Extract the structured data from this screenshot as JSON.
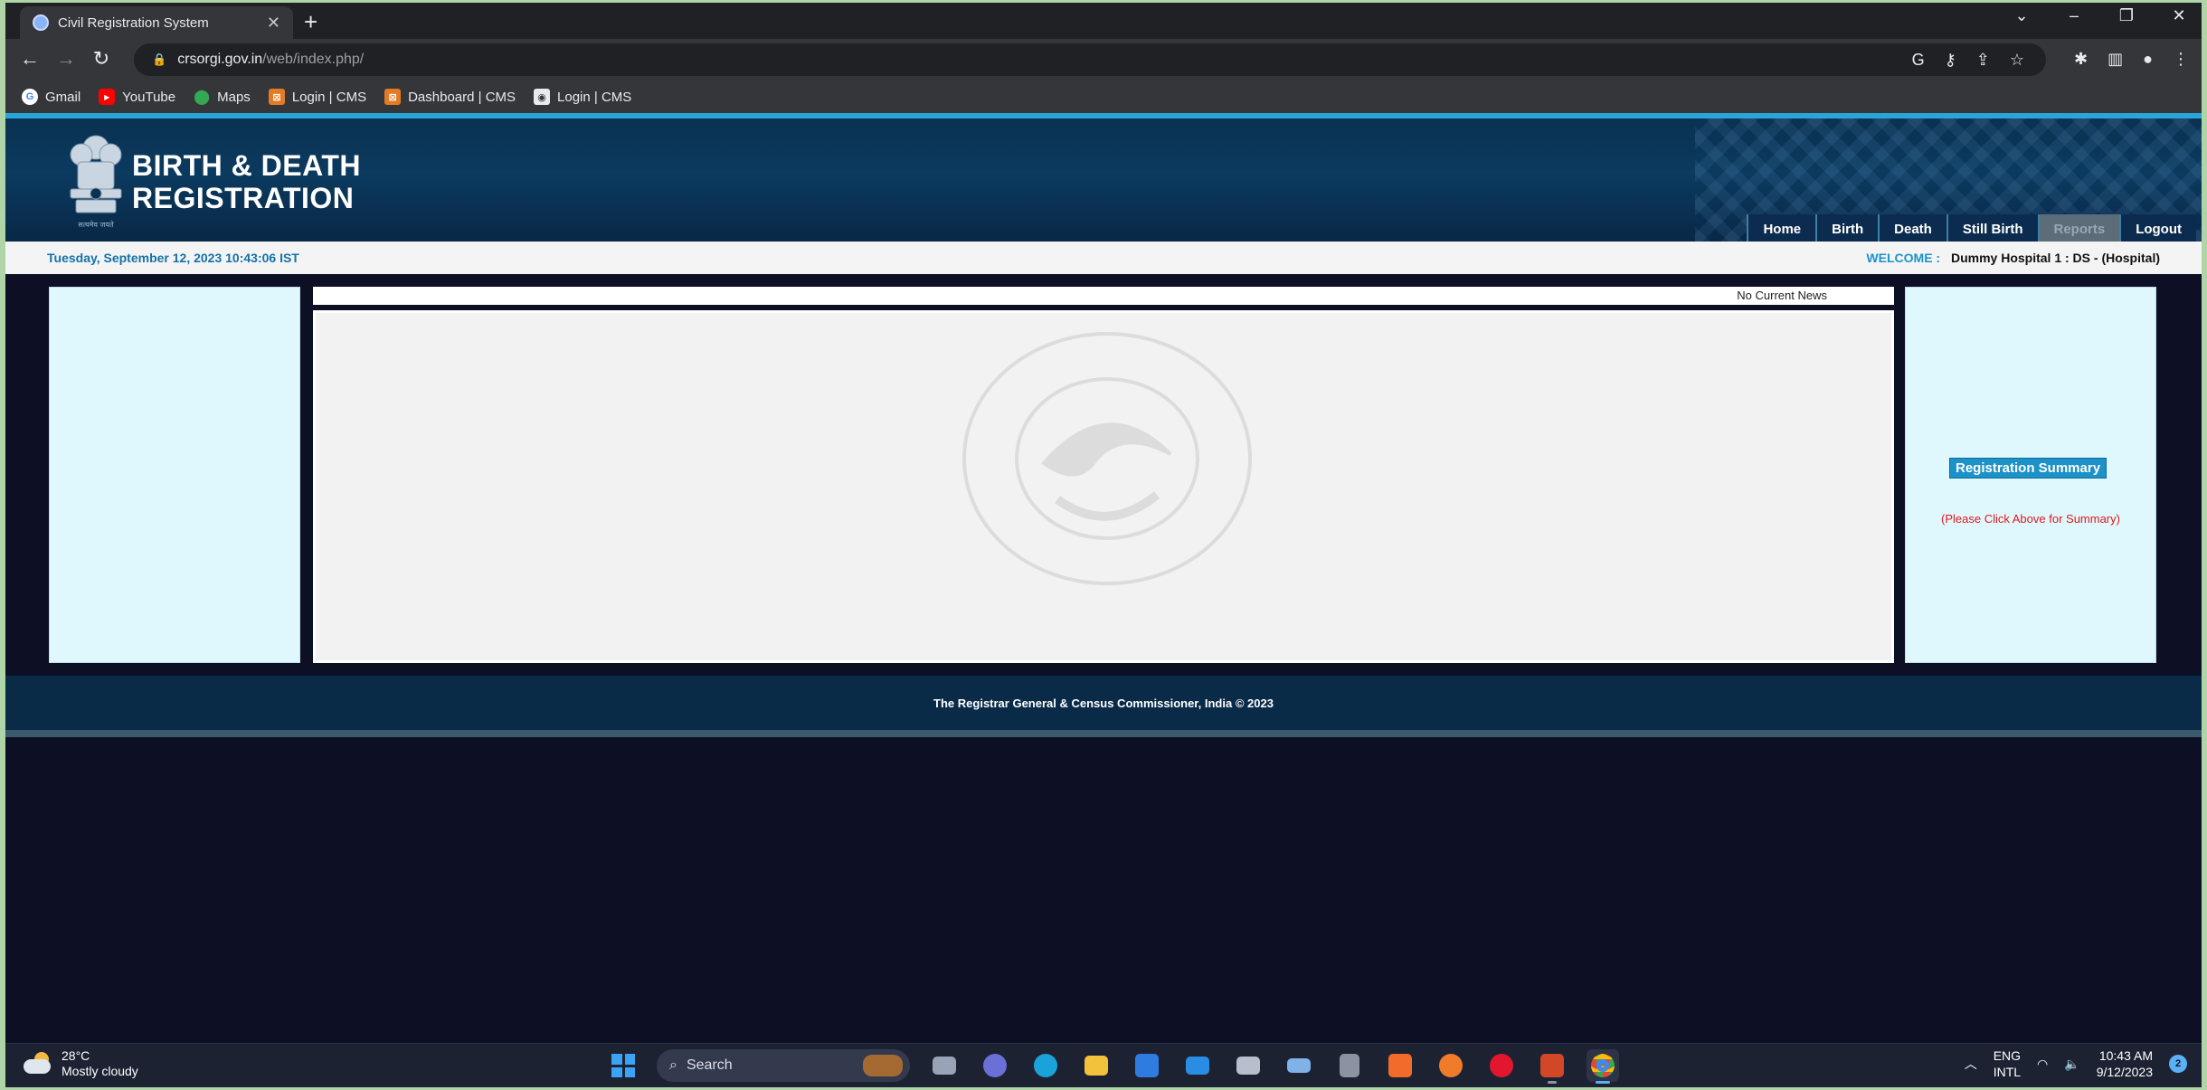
{
  "browser": {
    "tab_title": "Civil Registration System",
    "url_host": "crsorgi.gov.in",
    "url_path": "/web/index.php/",
    "bookmarks": [
      {
        "label": "Gmail",
        "icon": "google-icon"
      },
      {
        "label": "YouTube",
        "icon": "youtube-icon"
      },
      {
        "label": "Maps",
        "icon": "maps-icon"
      },
      {
        "label": "Login | CMS",
        "icon": "cms-icon"
      },
      {
        "label": "Dashboard | CMS",
        "icon": "cms-icon"
      },
      {
        "label": "Login | CMS",
        "icon": "login-icon"
      }
    ]
  },
  "site": {
    "title_line1": "BIRTH & DEATH",
    "title_line2": "REGISTRATION",
    "emblem_motto": "सत्यमेव जयते",
    "menu": [
      "Home",
      "Birth",
      "Death",
      "Still Birth",
      "Reports",
      "Logout"
    ],
    "active_menu": "Reports",
    "datetime": "Tuesday, September 12, 2023 10:43:06 IST",
    "welcome_label": "WELCOME :",
    "welcome_user": "Dummy Hospital 1 : DS -  (Hospital)",
    "news": "No Current News",
    "registration_summary": "Registration Summary",
    "summary_note": "(Please Click Above for Summary)",
    "footer": "The Registrar General & Census Commissioner, India © 2023",
    "colors": {
      "banner": "#0a3151",
      "accent": "#2aa5d8",
      "panel": "#dff8fe",
      "note": "#e0181b"
    }
  },
  "taskbar": {
    "temperature": "28°C",
    "weather": "Mostly cloudy",
    "search_placeholder": "Search",
    "lang_line1": "ENG",
    "lang_line2": "INTL",
    "time": "10:43 AM",
    "date": "9/12/2023",
    "notifications": "2"
  }
}
